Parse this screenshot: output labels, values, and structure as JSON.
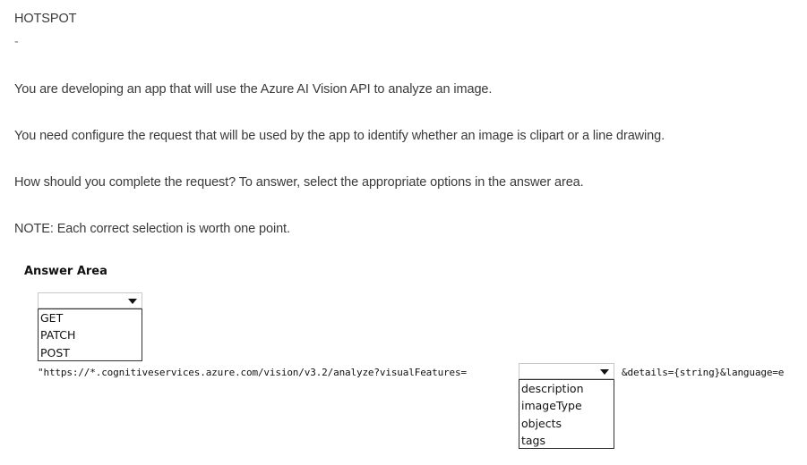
{
  "question": {
    "type_label": "HOTSPOT",
    "dash": "-",
    "paragraphs": [
      "You are developing an app that will use the Azure AI Vision API to analyze an image.",
      "You need configure the request that will be used by the app to identify whether an image is clipart or a line drawing.",
      "How should you complete the request? To answer, select the appropriate options in the answer area.",
      "NOTE: Each correct selection is worth one point."
    ]
  },
  "answer_area": {
    "title": "Answer Area",
    "method_select": {
      "selected": "",
      "options": [
        "GET",
        "PATCH",
        "POST"
      ]
    },
    "url_prefix": "\"https://*.cognitiveservices.azure.com/vision/v3.2/analyze?visualFeatures=",
    "feature_select": {
      "selected": "",
      "options": [
        "description",
        "imageType",
        "objects",
        "tags"
      ]
    },
    "url_suffix": "&details={string}&language=e"
  },
  "icons": {
    "dropdown_caret": "chevron-down-icon"
  }
}
